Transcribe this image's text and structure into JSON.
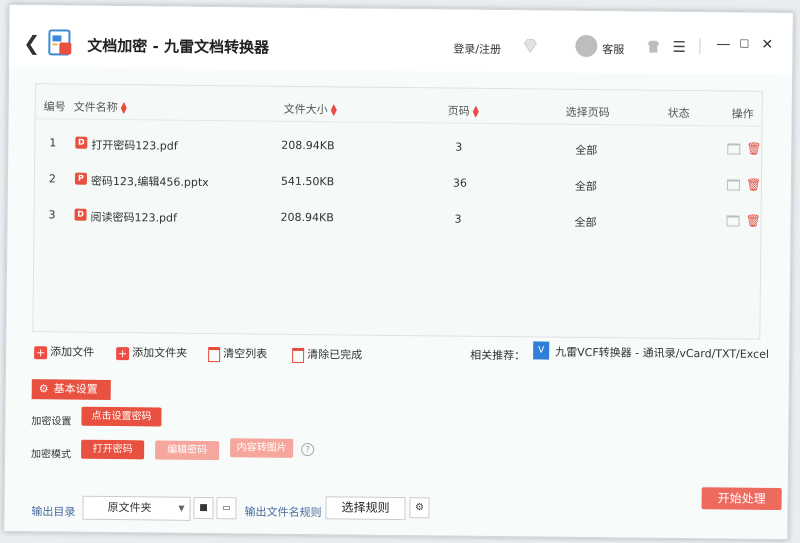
{
  "title": {
    "back": "❮",
    "app_title": "文档加密 - 九雷文档转换器",
    "login": "登录/注册",
    "service": "客服",
    "menu": "☰",
    "min": "—",
    "max": "☐",
    "close": "✕"
  },
  "table": {
    "headers": {
      "index": "编号",
      "name": "文件名称",
      "size": "文件大小",
      "pages": "页码",
      "select_pages": "选择页码",
      "status": "状态",
      "ops": "操作"
    },
    "rows": [
      {
        "index": "1",
        "type": "pdf",
        "name": "打开密码123.pdf",
        "size": "208.94KB",
        "pages": "3",
        "select": "全部",
        "status": ""
      },
      {
        "index": "2",
        "type": "ppt",
        "name": "密码123,编辑456.pptx",
        "size": "541.50KB",
        "pages": "36",
        "select": "全部",
        "status": ""
      },
      {
        "index": "3",
        "type": "pdf",
        "name": "阅读密码123.pdf",
        "size": "208.94KB",
        "pages": "3",
        "select": "全部",
        "status": ""
      }
    ]
  },
  "actions": {
    "add_file": "添加文件",
    "add_folder": "添加文件夹",
    "clear_list": "清空列表",
    "clear_done": "清除已完成",
    "related_label": "相关推荐：",
    "related_text": "九雷VCF转换器 - 通讯录/vCard/TXT/Excel"
  },
  "settings": {
    "tab": "基本设置",
    "encrypt_label": "加密设置",
    "encrypt_button": "点击设置密码",
    "mode_label": "加密模式",
    "modes": [
      "打开密码",
      "编辑密码",
      "内容转图片"
    ],
    "help": "?"
  },
  "output": {
    "dir_label": "输出目录",
    "dir_value": "原文件夹",
    "rule_label": "输出文件名规则",
    "rule_button": "选择规则",
    "start": "开始处理"
  },
  "colors": {
    "accent": "#e8503f",
    "accent_light": "#f5a79d",
    "link_blue": "#4a6b9c"
  }
}
